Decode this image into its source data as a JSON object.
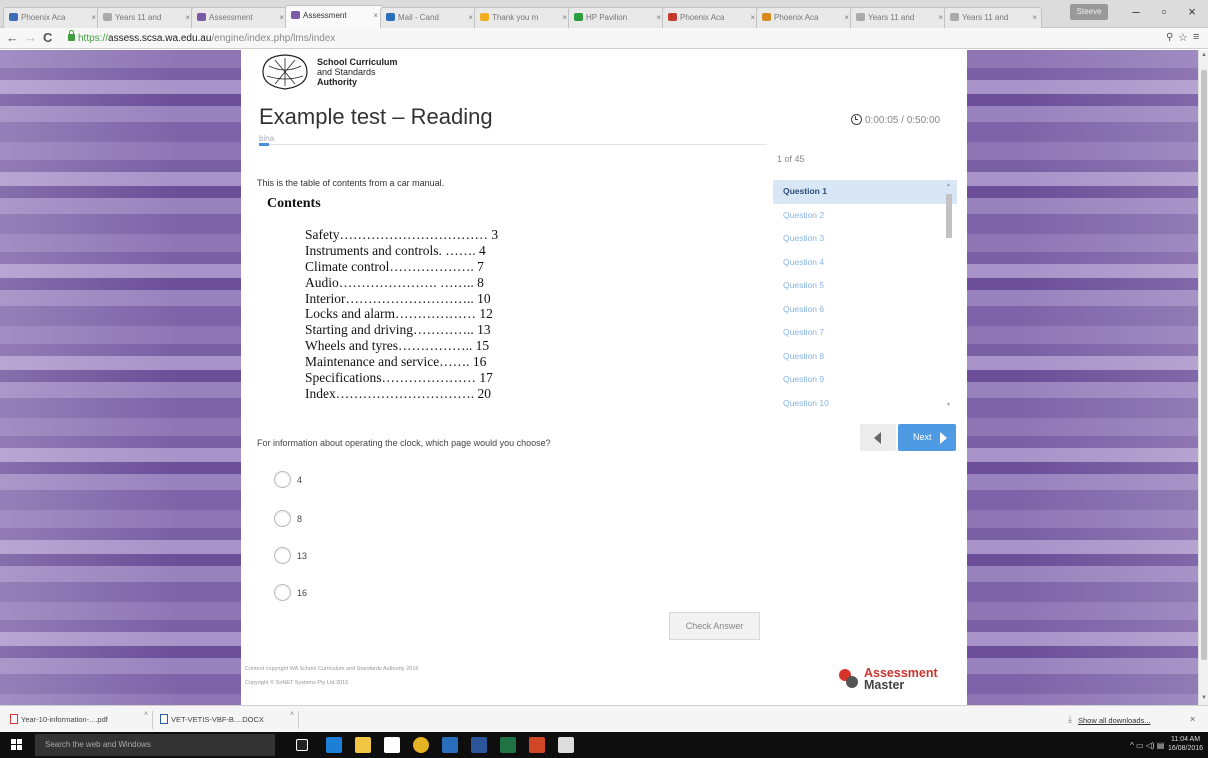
{
  "browser": {
    "tabs": [
      {
        "label": "Phoenix Aca",
        "color": "#3a6db5",
        "active": false
      },
      {
        "label": "Years 11 and",
        "color": "#aaaaaa",
        "active": false
      },
      {
        "label": "Assessment",
        "color": "#7b5aa6",
        "active": false
      },
      {
        "label": "Assessment",
        "color": "#7b5aa6",
        "active": true
      },
      {
        "label": "Mail - Cand",
        "color": "#2a6ebb",
        "active": false
      },
      {
        "label": "Thank you m",
        "color": "#f2b01e",
        "active": false
      },
      {
        "label": "HP Pavilion",
        "color": "#2a9d3c",
        "active": false
      },
      {
        "label": "Phoenix Aca",
        "color": "#c23b2c",
        "active": false
      },
      {
        "label": "Phoenix Aca",
        "color": "#d98a1d",
        "active": false
      },
      {
        "label": "Years 11 and",
        "color": "#aaaaaa",
        "active": false
      },
      {
        "label": "Years 11 and",
        "color": "#aaaaaa",
        "active": false
      }
    ],
    "profile": "Steeve",
    "url_scheme": "https://",
    "url_host": "assess.scsa.wa.edu.au",
    "url_path": "/engine/index.php/lms/index"
  },
  "page": {
    "logo_line1": "School Curriculum",
    "logo_line2": "and Standards",
    "logo_line3": "Authority",
    "title": "Example test – Reading",
    "subline": "bina",
    "timer": "0:00:05 / 0:50:00",
    "intro": "This is the table of contents from a car manual.",
    "contents_heading": "Contents",
    "toc": [
      "Safety……………………………  3",
      "Instruments and controls. …….  4",
      "Climate control……………….   7",
      "Audio…………………. ……..  8",
      "Interior……………………….. 10",
      "Locks and alarm……………… 12",
      "Starting and driving………….. 13",
      "Wheels and tyres…………….. 15",
      "Maintenance and service……. 16",
      "Specifications………………… 17",
      "Index…………………………. 20"
    ],
    "question": "For information about operating the clock, which page would you choose?",
    "options": [
      "4",
      "8",
      "13",
      "16"
    ],
    "check_answer": "Check Answer",
    "footer_line1": "Content copyright WA School Curriculum and Standards Authority 2016",
    "footer_line2": "Copyright © SoNET Systems Pty Ltd 2015",
    "am_line1": "Assessment",
    "am_line2": "Master"
  },
  "sidebar": {
    "count": "1 of 45",
    "questions": [
      "Question 1",
      "Question 2",
      "Question 3",
      "Question 4",
      "Question 5",
      "Question 6",
      "Question 7",
      "Question 8",
      "Question 9",
      "Question 10"
    ],
    "next_label": "Next"
  },
  "downloads": {
    "item1": "Year-10-information-....pdf",
    "item2": "VET-VETIS-VBF-B....DOCX",
    "show_all": "Show all downloads..."
  },
  "taskbar": {
    "search_placeholder": "Search the web and Windows",
    "time": "11:04 AM",
    "date": "16/08/2016"
  },
  "colors": {
    "accent_blue": "#4e9be3",
    "purple_bg": "#8e76b5",
    "current_question_bg": "#d8e6f5"
  }
}
